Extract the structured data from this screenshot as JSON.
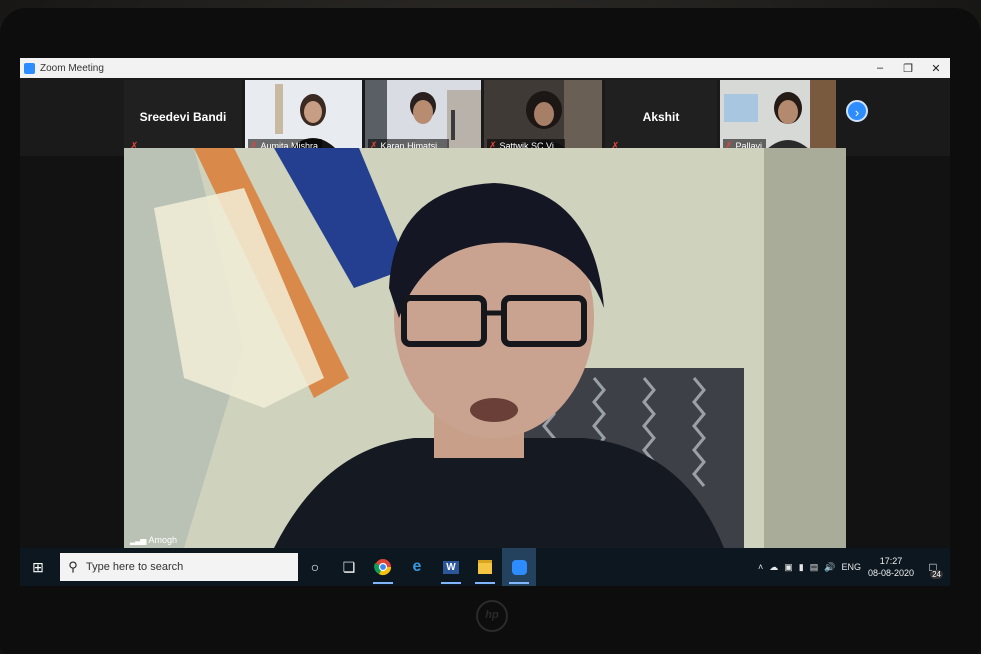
{
  "window": {
    "title": "Zoom Meeting"
  },
  "participants": [
    {
      "name": "Sreedevi Bandi",
      "video": false,
      "muted": true
    },
    {
      "name": "Aumita Mishra",
      "video": true,
      "muted": true
    },
    {
      "name": "Karan Himatsi...",
      "video": true,
      "muted": true
    },
    {
      "name": "Sattwik SC Vi...",
      "video": true,
      "muted": true
    },
    {
      "name": "Akshit",
      "video": false,
      "muted": true
    },
    {
      "name": "Pallavi",
      "video": true,
      "muted": true
    }
  ],
  "speaker": {
    "name": "Amogh"
  },
  "taskbar": {
    "search_placeholder": "Type here to search",
    "language": "ENG",
    "time": "17:27",
    "date": "08-08-2020",
    "notifications": "24"
  },
  "icons": [
    "windows-icon",
    "search-icon",
    "cortana-icon",
    "task-view-icon",
    "chrome-icon",
    "edge-icon",
    "word-icon",
    "file-explorer-icon",
    "zoom-icon",
    "next-page-icon",
    "mic-muted-icon",
    "signal-icon"
  ],
  "colors": {
    "zoom_blue": "#2d8cff",
    "mute_red": "#e0473a",
    "taskbar": "#0c1720"
  }
}
